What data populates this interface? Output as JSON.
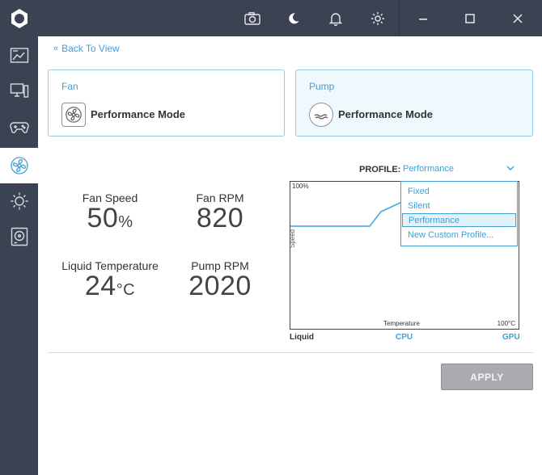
{
  "nav": {
    "back_label": "Back To View"
  },
  "cards": {
    "fan": {
      "title": "Fan",
      "mode": "Performance Mode"
    },
    "pump": {
      "title": "Pump",
      "mode": "Performance Mode"
    }
  },
  "stats": {
    "fan_speed": {
      "label": "Fan Speed",
      "value": "50",
      "unit": "%"
    },
    "fan_rpm": {
      "label": "Fan RPM",
      "value": "820"
    },
    "liquid_temp": {
      "label": "Liquid Temperature",
      "value": "24",
      "unit": "°C"
    },
    "pump_rpm": {
      "label": "Pump RPM",
      "value": "2020"
    }
  },
  "profile": {
    "label": "PROFILE:",
    "selected": "Performance",
    "options": [
      "Fixed",
      "Silent",
      "Performance",
      "New Custom Profile..."
    ]
  },
  "chart": {
    "y_top_label": "100%",
    "y_axis_label": "Speed",
    "x_axis_label": "Temperature",
    "x_max_label": "100°C"
  },
  "source_tabs": {
    "liquid": "Liquid",
    "cpu": "CPU",
    "gpu": "GPU"
  },
  "actions": {
    "apply": "APPLY"
  },
  "colors": {
    "chrome": "#3b4252",
    "accent": "#3f9fd6",
    "apply_disabled": "#a9abaf"
  }
}
